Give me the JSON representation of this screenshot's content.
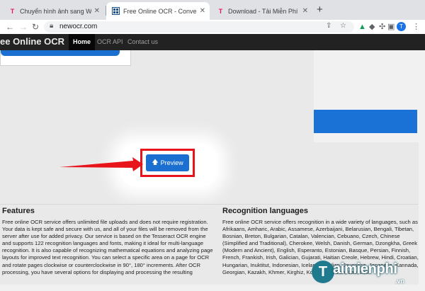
{
  "browser": {
    "tabs": [
      {
        "favicon": "T",
        "favicon_color": "#e8175d",
        "title": "Chuyển hình ảnh sang Word, đổ",
        "active": false
      },
      {
        "favicon": "ocr",
        "favicon_color": "#1b4f8a",
        "title": "Free Online OCR - Convert JPEG",
        "active": true
      },
      {
        "favicon": "T",
        "favicon_color": "#e8175d",
        "title": "Download - Tải Miễn Phí VN - Ph",
        "active": false
      }
    ],
    "new_tab_label": "+",
    "url": "newocr.com",
    "avatar_letter": "T"
  },
  "site_nav": {
    "brand": "ee Online OCR",
    "items": [
      {
        "label": "Home",
        "active": true
      },
      {
        "label": "OCR API",
        "active": false
      },
      {
        "label": "Contact us",
        "active": false
      }
    ]
  },
  "main": {
    "preview_button_label": "Preview",
    "features": {
      "heading": "Features",
      "body": "Free online OCR service offers unlimited file uploads and does not require registration. Your data is kept safe and secure with us, and all of your files will be removed from the server after use for added privacy. Our service is based on the Tesseract OCR engine and supports 122 recognition languages and fonts, making it ideal for multi-language recognition. It is also capable of recognizing mathematical equations and analyzing page layouts for improved text recognition. You can select a specific area on a page for OCR and rotate pages clockwise or counterclockwise in 90°, 180° increments. After OCR processing, you have several options for displaying and processing the resulting"
    },
    "languages": {
      "heading": "Recognition languages",
      "body": "Free online OCR service offers recognition in a wide variety of languages, such as Afrikaans, Amharic, Arabic, Assamese, Azerbaijani, Belarusian, Bengali, Tibetan, Bosnian, Breton, Bulgarian, Catalan, Valencian, Cebuano, Czech, Chinese (Simplified and Traditional), Cherokee, Welsh, Danish, German, Dzongkha, Greek (Modern and Ancient), English, Esperanto, Estonian, Basque, Persian, Finnish, French, Frankish, Irish, Galician, Gujarati, Haitian Creole, Hebrew, Hindi, Croatian, Hungarian, Inuktitut, Indonesian, Icelandic, Italian, Javanese, Japanese, Kannada, Georgian, Kazakh, Khmer, Kirghiz, Korean, Kurdish, Lao, Latin"
    }
  },
  "watermark": {
    "brand_initial": "T",
    "brand_rest": "aimienphi",
    "tld": ".vn"
  },
  "colors": {
    "accent_blue": "#1a6fd0",
    "callout_red": "#e8141b",
    "nav_bg": "#222222"
  }
}
